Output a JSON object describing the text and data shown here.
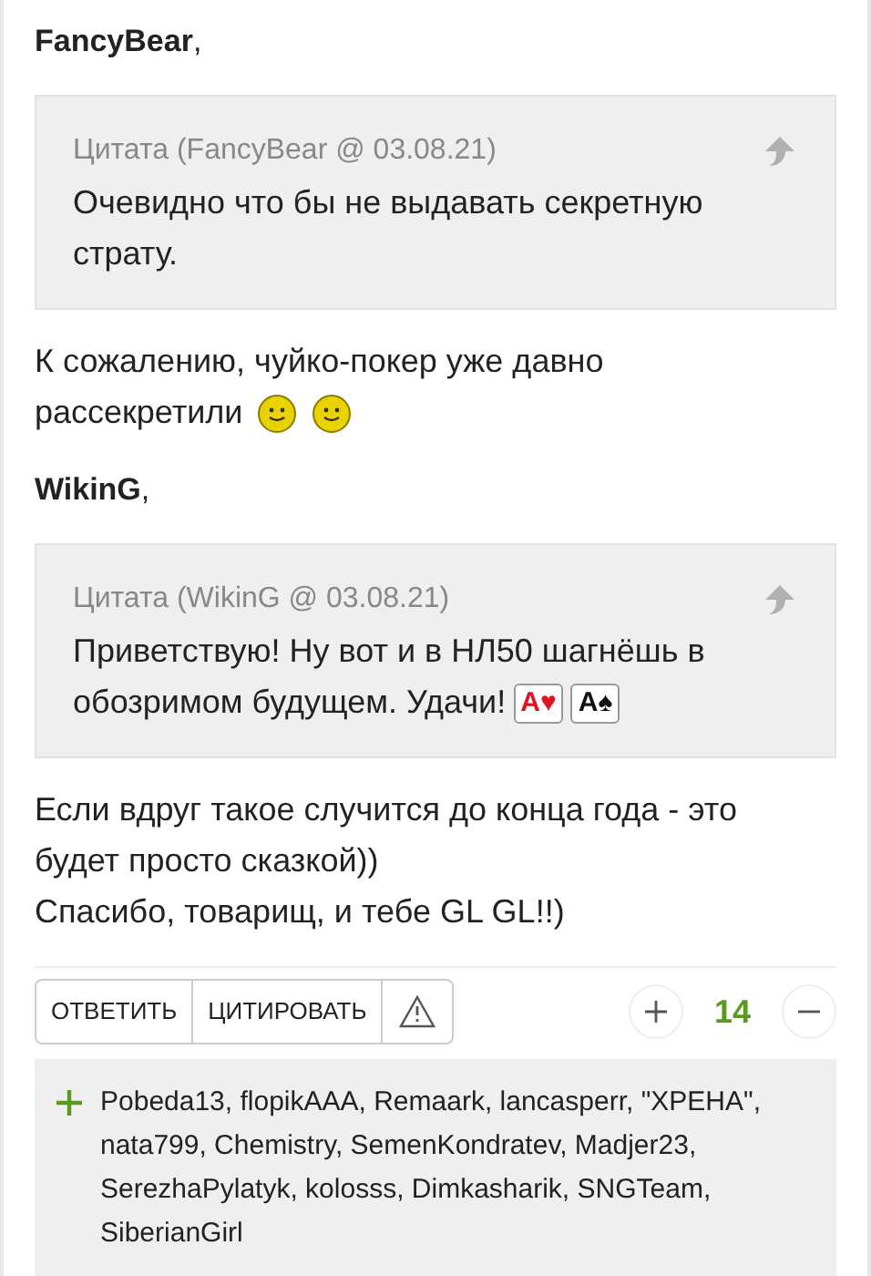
{
  "posts": [
    {
      "author": "**FancyBear**,",
      "quote": {
        "header": "Цитата (FancyBear @ 03.08.21)",
        "content": [
          {
            "kind": "text",
            "text": "Очевидно что бы не выдавать секретную страту."
          }
        ]
      },
      "paragraphs": [
        [
          {
            "kind": "text",
            "text": "К сожалению, чуйко-покер уже давно рассекретили"
          },
          {
            "kind": "smiley"
          },
          {
            "kind": "smiley"
          }
        ]
      ]
    },
    {
      "author": "**WikinG**,",
      "quote": {
        "header": "Цитата (WikinG @ 03.08.21)",
        "content": [
          {
            "kind": "text",
            "text": "Приветствую! Ну вот и в НЛ50 шагнёшь в обозримом будущем. Удачи!"
          },
          {
            "kind": "card",
            "text": "A♥",
            "color": "#e0141e"
          },
          {
            "kind": "card",
            "text": "A♠",
            "color": "#111111"
          }
        ]
      },
      "paragraphs": [
        [
          {
            "kind": "text",
            "text": "Если вдруг такое случится до конца года - это будет просто сказкой))"
          }
        ],
        [
          {
            "kind": "text",
            "text": "Спасибо, товарищ, и тебе GL GL!!)"
          }
        ]
      ]
    }
  ],
  "actions": {
    "buttons": [
      "ОТВЕТИТЬ",
      "ЦИТИРОВАТЬ"
    ],
    "rating": "14"
  },
  "likes": "Pobeda13, flopikAAA, Remaark, lancasperr, \"ХРЕНА\", nata799, Chemistry, SemenKondratev, Madjer23, SerezhaPylatyk, kolosss, Dimkasharik, SNGTeam, SiberianGirl"
}
